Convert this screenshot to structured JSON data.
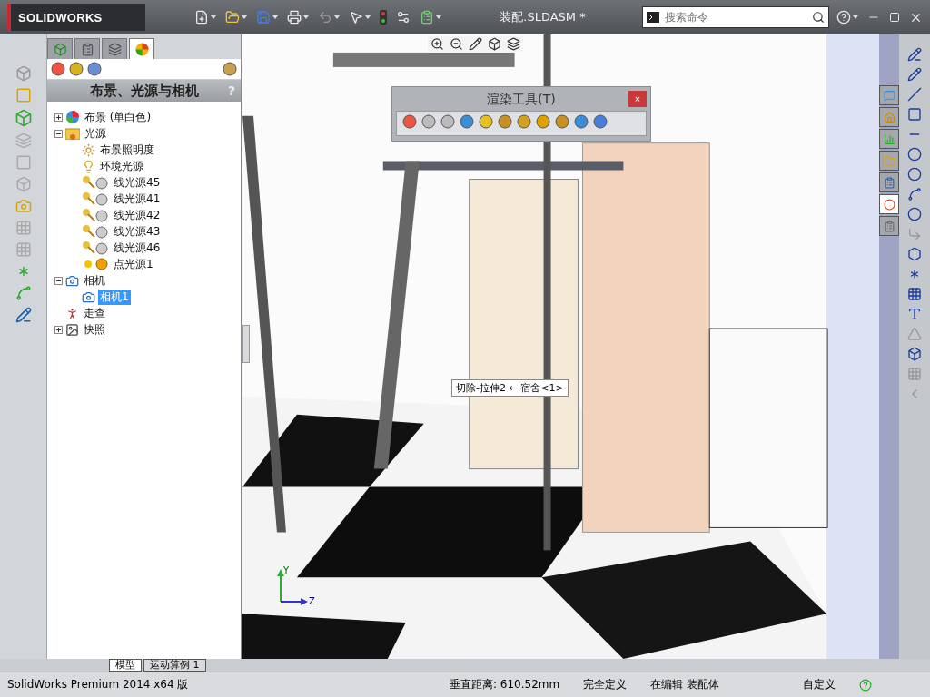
{
  "app": {
    "logo": "SOLIDWORKS"
  },
  "window": {
    "title": "装配.SLDASM *"
  },
  "search": {
    "placeholder": "搜索命令"
  },
  "panel": {
    "tabs": [
      {
        "kind": "feature",
        "selected": false
      },
      {
        "kind": "property",
        "selected": false
      },
      {
        "kind": "config",
        "selected": false
      },
      {
        "kind": "display",
        "selected": true
      }
    ],
    "title": "布景、光源与相机",
    "help": "?",
    "tree": [
      {
        "label": "布景 (单白色)",
        "kind": "scene",
        "expanded": false,
        "selected": false
      },
      {
        "label": "光源",
        "kind": "folder",
        "expanded": true,
        "selected": false,
        "children": [
          {
            "label": "布景照明度",
            "kind": "scene-light",
            "selected": false
          },
          {
            "label": "环境光源",
            "kind": "bulb",
            "selected": false
          },
          {
            "label": "线光源45",
            "kind": "directional",
            "selected": false
          },
          {
            "label": "线光源41",
            "kind": "directional",
            "selected": false
          },
          {
            "label": "线光源42",
            "kind": "directional",
            "selected": false
          },
          {
            "label": "线光源43",
            "kind": "directional",
            "selected": false
          },
          {
            "label": "线光源46",
            "kind": "directional",
            "selected": false
          },
          {
            "label": "点光源1",
            "kind": "point",
            "selected": false
          }
        ]
      },
      {
        "label": "相机",
        "kind": "camera",
        "expanded": true,
        "selected": false,
        "children": [
          {
            "label": "相机1",
            "kind": "camera",
            "selected": true
          }
        ]
      },
      {
        "label": "走查",
        "kind": "walk",
        "selected": false
      },
      {
        "label": "快照",
        "kind": "snapshot",
        "expanded": false,
        "selected": false
      }
    ]
  },
  "render_toolbar": {
    "title": "渲染工具(T)",
    "close": "×"
  },
  "tooltip": "切除-拉伸2 ← 宿舍<1>",
  "triad": {
    "y": "Y",
    "z": "Z"
  },
  "bottom_tabs": [
    {
      "label": "模型",
      "selected": true
    },
    {
      "label": "运动算例 1",
      "selected": false
    }
  ],
  "status_bar": {
    "product": "SolidWorks Premium 2014 x64 版",
    "distance": "垂直距离: 610.52mm",
    "state": "完全定义",
    "editing": "在编辑 装配体",
    "units": "自定义"
  }
}
